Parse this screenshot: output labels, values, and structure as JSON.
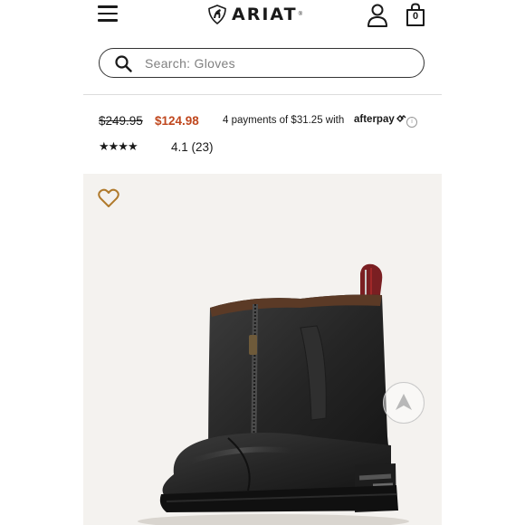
{
  "header": {
    "brand": "ARIAT",
    "bag_count": "0"
  },
  "search": {
    "placeholder": "Search: Gloves"
  },
  "product": {
    "original_price": "$249.95",
    "sale_price": "$124.98",
    "installment_text": "4 payments of $31.25 with",
    "installment_provider": "afterpay",
    "rating_stars": "★★★★",
    "rating_text": "4.1  (23)"
  },
  "colors": {
    "sale": "#c0481f",
    "wishlist": "#b07a2c"
  }
}
